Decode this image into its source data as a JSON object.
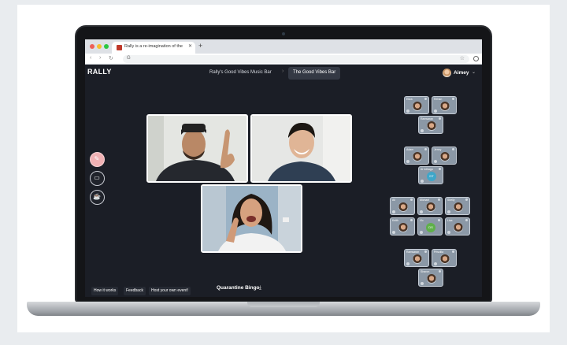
{
  "browser": {
    "tab_title": "Rally is a re-imagination of the",
    "tab_close": "✕",
    "new_tab": "+",
    "back": "‹",
    "forward": "›",
    "reload": "↻",
    "address_icon": "G",
    "bookmark_icon": "star-icon"
  },
  "app": {
    "logo": "RALLY",
    "rooms": [
      {
        "label": "Rally's Good Vibes Music Bar",
        "active": false
      },
      {
        "label": "The Good Vibes Bar",
        "active": true
      }
    ],
    "breadcrumb_separator": "›",
    "user": {
      "name": "Aimey",
      "chevron": "⌄"
    }
  },
  "controls": [
    {
      "name": "microphone-icon",
      "glyph": "🎤"
    },
    {
      "name": "camera-icon",
      "glyph": "▭"
    },
    {
      "name": "drink-icon",
      "glyph": "☕"
    }
  ],
  "tables": [
    {
      "seats": [
        {
          "name": "Eliza",
          "type": "face"
        },
        {
          "name": "Rehan",
          "type": "face"
        },
        {
          "name": "Ramsaran",
          "type": "face"
        }
      ]
    },
    {
      "seats": [
        {
          "name": "Adam",
          "type": "face"
        },
        {
          "name": "Jenny",
          "type": "face"
        },
        {
          "name": "Al Inthago",
          "type": "initials",
          "initials": "DT",
          "color": "blue"
        }
      ]
    },
    {
      "seats": [
        {
          "name": "Ali",
          "type": "face"
        },
        {
          "name": "Michael",
          "type": "face"
        },
        {
          "name": "Shelly",
          "type": "face"
        },
        {
          "name": "Keith",
          "type": "face"
        },
        {
          "name": "Vic",
          "type": "initials",
          "initials": "DS",
          "color": "green"
        },
        {
          "name": "Lisa",
          "type": "face"
        }
      ]
    },
    {
      "seats": [
        {
          "name": "Ramsaran",
          "type": "face"
        },
        {
          "name": "Priscilla",
          "type": "face"
        },
        {
          "name": "Sharon",
          "type": "face"
        }
      ]
    }
  ],
  "footer": {
    "how_it_works": "How it works",
    "feedback": "Feedback",
    "host_event": "Host your own event!",
    "bingo": "Quarantine Bingo",
    "download_icon": "⤓"
  }
}
